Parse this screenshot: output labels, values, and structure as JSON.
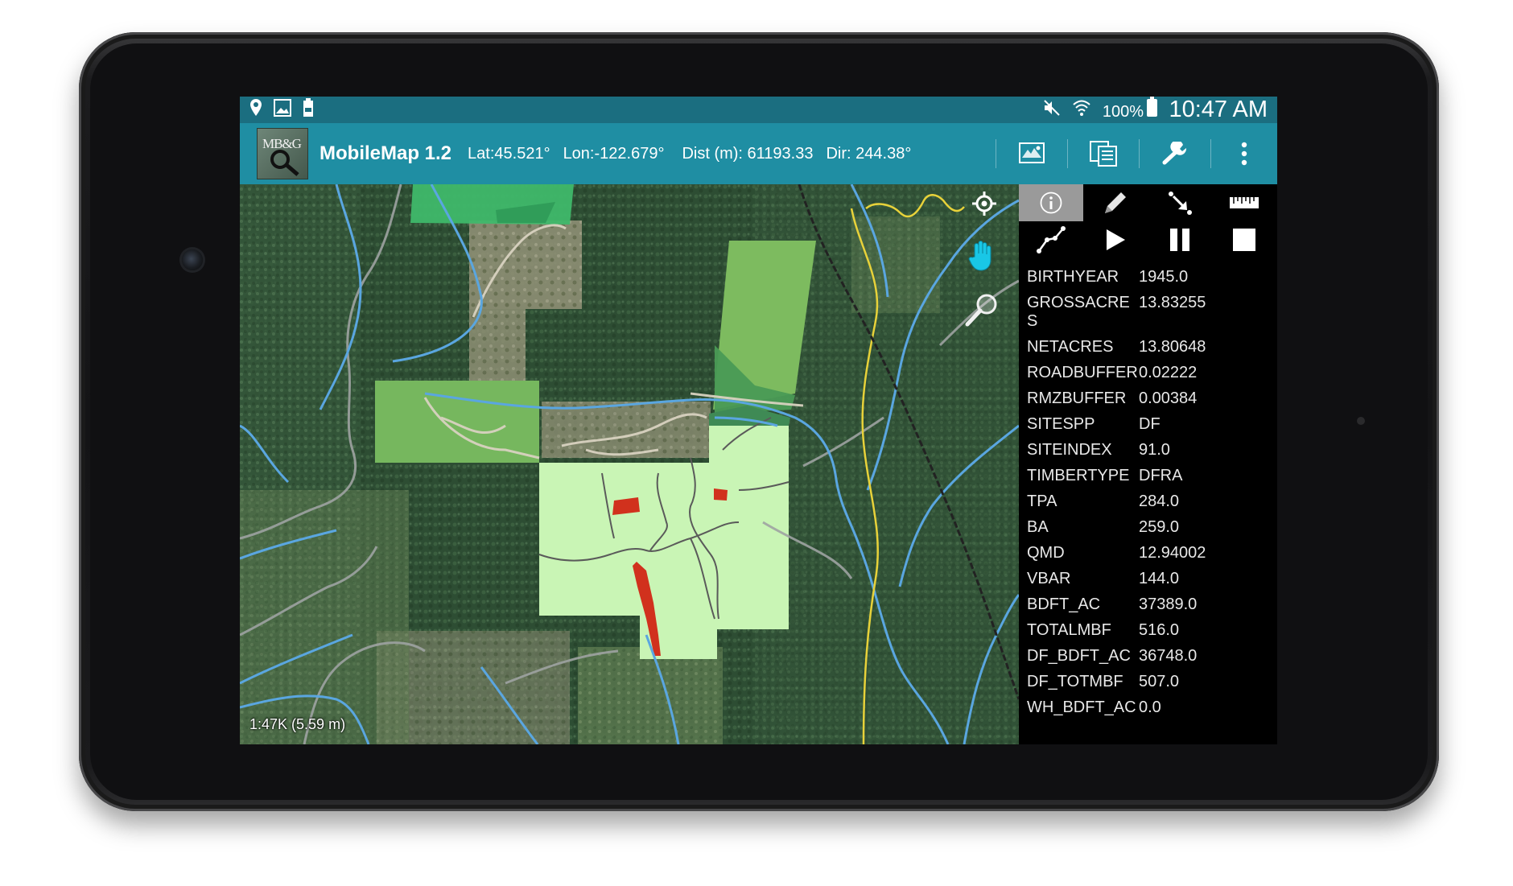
{
  "status_bar": {
    "left_icons": [
      "location-pin-icon",
      "image-icon",
      "battery-saver-icon"
    ],
    "right_icons": [
      "mute-icon",
      "wifi-icon"
    ],
    "battery_text": "100%",
    "time": "10:47 AM",
    "color": "#1b6e80"
  },
  "action_bar": {
    "logo_text": "MB&G",
    "title": "MobileMap 1.2",
    "lat": "Lat:45.521°",
    "lon": "Lon:-122.679°",
    "dist": "Dist (m): 61193.33",
    "dir": "Dir: 244.38°",
    "actions": [
      "map-layers-icon",
      "layer-list-icon",
      "wrench-icon",
      "overflow-menu-icon"
    ],
    "color": "#1f8ea3"
  },
  "map": {
    "scale": "1:47K (5.59 m)",
    "tools": [
      "gps-target-icon",
      "pan-hand-icon",
      "identify-magnifier-icon"
    ]
  },
  "panel": {
    "tools_row1": [
      "info-icon",
      "pencil-icon",
      "arrow-point-icon",
      "ruler-icon"
    ],
    "tools_row2": [
      "polyline-icon",
      "play-icon",
      "pause-icon",
      "stop-icon"
    ],
    "attributes": [
      {
        "key": "BIRTHYEAR",
        "value": "1945.0"
      },
      {
        "key": "GROSSACRES",
        "value": "13.83255"
      },
      {
        "key": "NETACRES",
        "value": "13.80648"
      },
      {
        "key": "ROADBUFFER",
        "value": "0.02222"
      },
      {
        "key": "RMZBUFFER",
        "value": "0.00384"
      },
      {
        "key": "SITESPP",
        "value": "DF"
      },
      {
        "key": "SITEINDEX",
        "value": "91.0"
      },
      {
        "key": "TIMBERTYPE",
        "value": "DFRA"
      },
      {
        "key": "TPA",
        "value": "284.0"
      },
      {
        "key": "BA",
        "value": "259.0"
      },
      {
        "key": "QMD",
        "value": "12.94002"
      },
      {
        "key": "VBAR",
        "value": "144.0"
      },
      {
        "key": "BDFT_AC",
        "value": "37389.0"
      },
      {
        "key": "TOTALMBF",
        "value": "516.0"
      },
      {
        "key": "DF_BDFT_AC",
        "value": "36748.0"
      },
      {
        "key": "DF_TOTMBF",
        "value": "507.0"
      },
      {
        "key": "WH_BDFT_AC",
        "value": "0.0"
      }
    ]
  },
  "colors": {
    "stand_mid": "#76b75e",
    "stand_selected": "#c9f5b5",
    "stand_top": "#3fb86a",
    "red_unit": "#d1311d",
    "streams": "#5aa6e0",
    "road_yellow": "#e8d23a"
  }
}
